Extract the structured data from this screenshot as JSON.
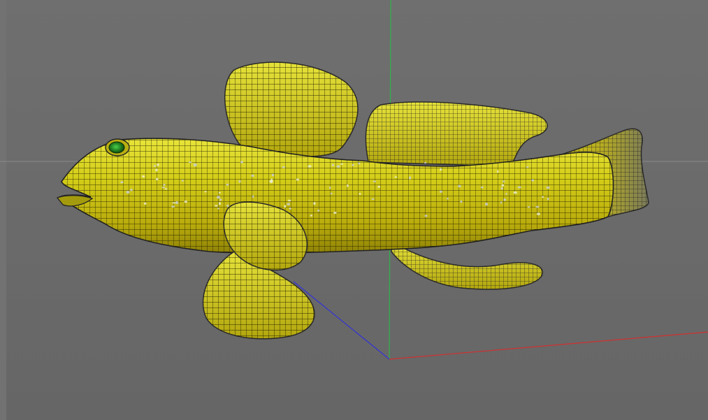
{
  "viewport": {
    "mode": "3d-perspective",
    "background_color": "#6b6b6b",
    "display_mode": "wireframe-on-shaded"
  },
  "axes": {
    "x_axis_color": "#d23030",
    "y_axis_color": "#2fb34a",
    "z_axis_color": "#3232d6",
    "horizon_line_color": "#8a8a8a"
  },
  "model": {
    "object": "fish",
    "surface_color": "#c8c214",
    "wire_color": "#1a1a00",
    "eye_color": "#1f7a1f",
    "fin_wire_color": "#2a2a2a"
  }
}
